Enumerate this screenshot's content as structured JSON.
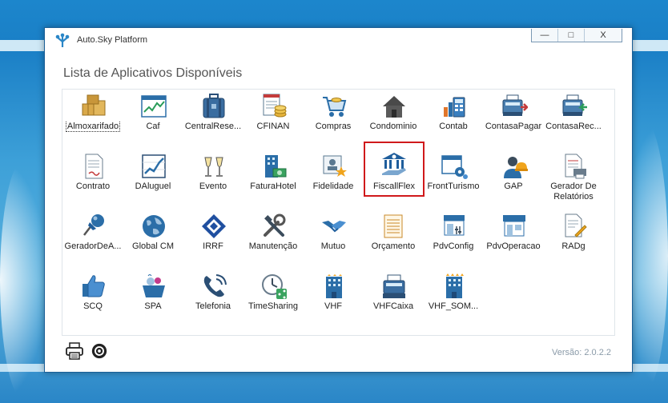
{
  "window": {
    "title": "Auto.Sky Platform",
    "minimize_label": "—",
    "maximize_label": "□",
    "close_label": "X"
  },
  "section_title": "Lista de Aplicativos Disponíveis",
  "apps": [
    {
      "label": "Almoxarifado",
      "icon": "warehouse-boxes-icon"
    },
    {
      "label": "Caf",
      "icon": "chart-window-icon"
    },
    {
      "label": "CentralRese...",
      "icon": "suitcase-icon"
    },
    {
      "label": "CFINAN",
      "icon": "document-coins-icon"
    },
    {
      "label": "Compras",
      "icon": "shopping-cart-icon"
    },
    {
      "label": "Condominio",
      "icon": "house-icon"
    },
    {
      "label": "Contab",
      "icon": "calculator-chart-icon"
    },
    {
      "label": "ContasaPagar",
      "icon": "cash-register-out-icon"
    },
    {
      "label": "ContasaRec...",
      "icon": "cash-register-in-icon"
    },
    {
      "label": "Contrato",
      "icon": "contract-document-icon"
    },
    {
      "label": "DAluguel",
      "icon": "growth-chart-icon"
    },
    {
      "label": "Evento",
      "icon": "champagne-glasses-icon"
    },
    {
      "label": "FaturaHotel",
      "icon": "hotel-money-icon"
    },
    {
      "label": "Fidelidade",
      "icon": "loyalty-card-star-icon"
    },
    {
      "label": "FiscallFlex",
      "icon": "bank-hand-icon"
    },
    {
      "label": "FrontTurismo",
      "icon": "window-gears-icon"
    },
    {
      "label": "GAP",
      "icon": "worker-helmet-icon"
    },
    {
      "label": "Gerador De Relatórios",
      "icon": "report-printer-icon"
    },
    {
      "label": "GeradorDeA...",
      "icon": "pushpin-icon"
    },
    {
      "label": "Global CM",
      "icon": "globe-icon"
    },
    {
      "label": "IRRF",
      "icon": "tax-diamond-logo-icon"
    },
    {
      "label": "Manutenção",
      "icon": "tools-icon"
    },
    {
      "label": "Mutuo",
      "icon": "handshake-icon"
    },
    {
      "label": "Orçamento",
      "icon": "budget-sheet-icon"
    },
    {
      "label": "PdvConfig",
      "icon": "store-settings-icon"
    },
    {
      "label": "PdvOperacao",
      "icon": "store-icon"
    },
    {
      "label": "RADg",
      "icon": "document-pen-icon"
    },
    {
      "label": "SCQ",
      "icon": "thumbs-up-icon"
    },
    {
      "label": "SPA",
      "icon": "spa-basket-icon"
    },
    {
      "label": "Telefonia",
      "icon": "phone-handset-icon"
    },
    {
      "label": "TimeSharing",
      "icon": "clock-share-icon"
    },
    {
      "label": "VHF",
      "icon": "hotel-building-icon"
    },
    {
      "label": "VHFCaixa",
      "icon": "cash-register-icon"
    },
    {
      "label": "VHF_SOM...",
      "icon": "hotel-building-stars-icon"
    }
  ],
  "footer": {
    "version": "Versão: 2.0.2.2"
  },
  "colors": {
    "accent_blue": "#1f6fb3",
    "selection_red": "#d0191b"
  }
}
